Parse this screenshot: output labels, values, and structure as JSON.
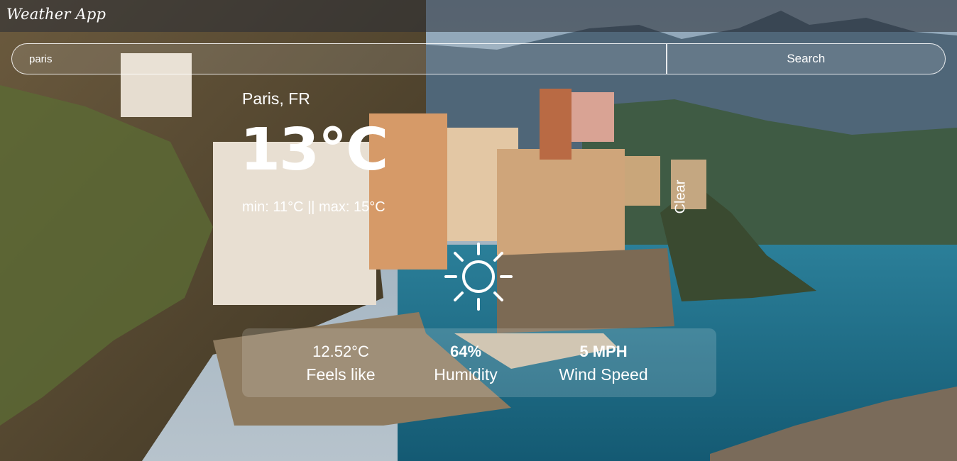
{
  "app": {
    "title": "Weather App"
  },
  "search": {
    "value": "paris",
    "button_label": "Search"
  },
  "weather": {
    "location": "Paris, FR",
    "temperature": "13°C",
    "min_max": "min: 11°C || max: 15°C",
    "condition": "Clear",
    "condition_icon": "sun-icon"
  },
  "stats": {
    "feels_like": {
      "value": "12.52°C",
      "label": "Feels like"
    },
    "humidity": {
      "value": "64%",
      "label": "Humidity"
    },
    "wind_speed": {
      "value": "5 MPH",
      "label": "Wind Speed"
    }
  },
  "colors": {
    "text": "#ffffff",
    "topbar": "#282c34",
    "sea": "#1f6f8b"
  }
}
